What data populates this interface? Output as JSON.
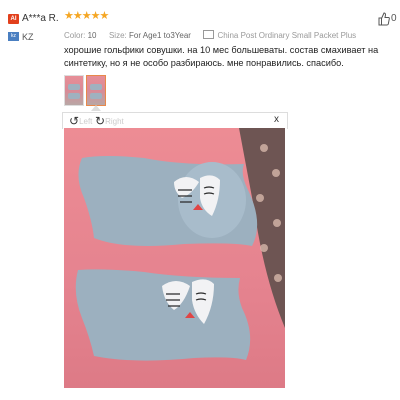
{
  "reviewer": {
    "avatar_text": "AI",
    "name": "A***a R.",
    "country_code": "KZ",
    "country_flag_text": "kz"
  },
  "rating": {
    "stars": 5,
    "stars_text": "★★★★★"
  },
  "meta": {
    "color_label": "Color:",
    "color_value": "10",
    "size_label": "Size:",
    "size_value": "For Age1 to3Year",
    "shipping": "China Post Ordinary Small Packet Plus"
  },
  "like": {
    "count": "0",
    "icon": "thumbs-up-icon"
  },
  "review_text": "хорошие гольфики совушки. на 10 мес большеваты. состав смахивает на синтетику, но я не особо разбираюсь. мне понравились. спасибо.",
  "gallery": {
    "thumbnails": [
      {
        "name": "review-photo-thumbnail-1"
      },
      {
        "name": "review-photo-thumbnail-2",
        "selected": true
      }
    ]
  },
  "viewer": {
    "rotate_left_label": "Left",
    "rotate_right_label": "Right",
    "close_label": "x"
  },
  "colors": {
    "star": "#f5a623",
    "photo_background": "#e5838f",
    "sock": "#9fb1bf",
    "thumb_selected_border": "#e8884a"
  }
}
